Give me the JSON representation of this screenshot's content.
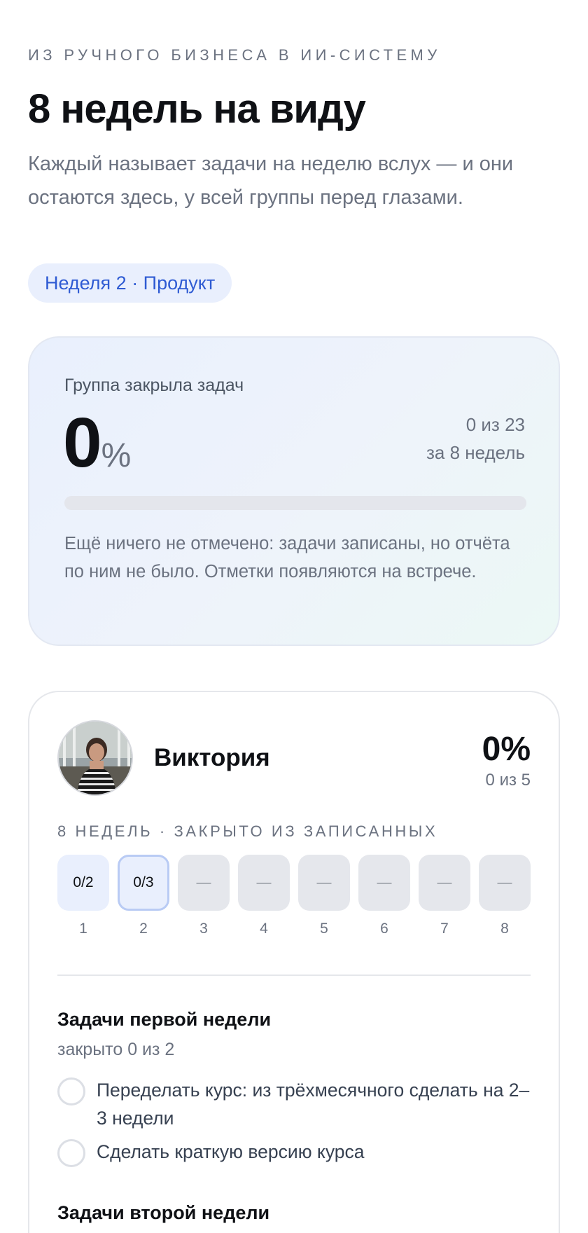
{
  "header": {
    "eyebrow": "ИЗ РУЧНОГО БИЗНЕСА В ИИ-СИСТЕМУ",
    "title": "8 недель на виду",
    "subtitle": "Каждый называет задачи на неделю вслух — и они остаются здесь, у всей группы перед глазами.",
    "pill": "Неделя 2 · Продукт"
  },
  "summary": {
    "label": "Группа закрыла задач",
    "percent_value": "0",
    "percent_unit": "%",
    "count_line1": "0 из 23",
    "count_line2": "за 8 недель",
    "progress_fraction": 0,
    "note": "Ещё ничего не отмечено: задачи записаны, но отчёта по ним не было. Отметки появляются на встрече."
  },
  "member": {
    "name": "Виктория",
    "percent": "0%",
    "count": "0 из 5",
    "weeks_heading": "8 НЕДЕЛЬ · ЗАКРЫТО ИЗ ЗАПИСАННЫХ",
    "weeks": [
      {
        "value": "0/2",
        "num": "1",
        "state": "done"
      },
      {
        "value": "0/3",
        "num": "2",
        "state": "current"
      },
      {
        "value": "—",
        "num": "3",
        "state": "empty"
      },
      {
        "value": "—",
        "num": "4",
        "state": "empty"
      },
      {
        "value": "—",
        "num": "5",
        "state": "empty"
      },
      {
        "value": "—",
        "num": "6",
        "state": "empty"
      },
      {
        "value": "—",
        "num": "7",
        "state": "empty"
      },
      {
        "value": "—",
        "num": "8",
        "state": "empty"
      }
    ],
    "task_groups": [
      {
        "title": "Задачи первой недели",
        "subtitle": "закрыто 0 из 2",
        "tasks": [
          "Переделать курс: из трёхмесячного сделать на 2–3 недели",
          "Сделать краткую версию курса"
        ]
      },
      {
        "title": "Задачи второй недели"
      }
    ]
  },
  "colors": {
    "accent": "#2f5bd3",
    "pill_bg": "#e9effd",
    "muted_text": "#6b7280"
  }
}
